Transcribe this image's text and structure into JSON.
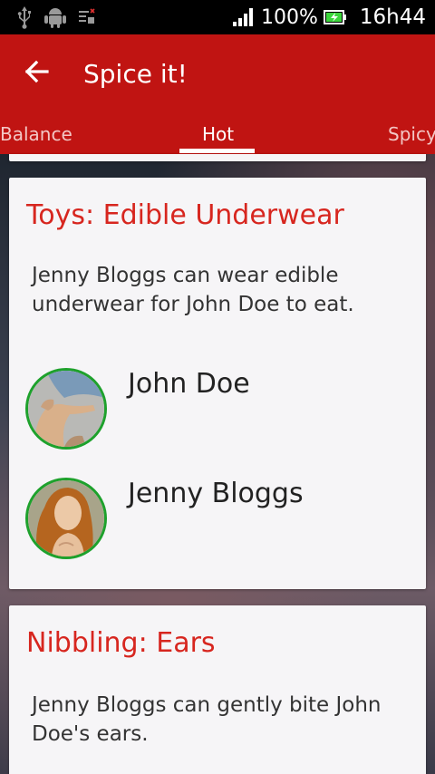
{
  "status_bar": {
    "icons": [
      "usb-icon",
      "android-icon",
      "notification-icon"
    ],
    "battery_percent_text": "100%",
    "time": "16h44",
    "colors": {
      "background": "#000000",
      "text": "#ffffff",
      "battery": "#3cd63c"
    }
  },
  "toolbar": {
    "title": "Spice it!",
    "back_icon": "arrow-left-icon",
    "color": "#c01412"
  },
  "tabs": {
    "items": [
      {
        "label": "Balance",
        "active": false
      },
      {
        "label": "Hot",
        "active": true
      },
      {
        "label": "Spicy",
        "active": false
      }
    ]
  },
  "cards": [
    {
      "title": "Toys: Edible Underwear",
      "description": "Jenny Bloggs can wear edible underwear for John Doe to eat.",
      "people": [
        {
          "name": "John Doe",
          "avatar": "avatar-creation-of-adam"
        },
        {
          "name": "Jenny Bloggs",
          "avatar": "avatar-birth-of-venus"
        }
      ]
    },
    {
      "title": "Nibbling: Ears",
      "description": "Jenny Bloggs can gently bite John Doe's ears."
    }
  ],
  "colors": {
    "accent": "#d7261f",
    "avatar_border": "#1ea12c",
    "card_bg": "#f6f5f7"
  }
}
